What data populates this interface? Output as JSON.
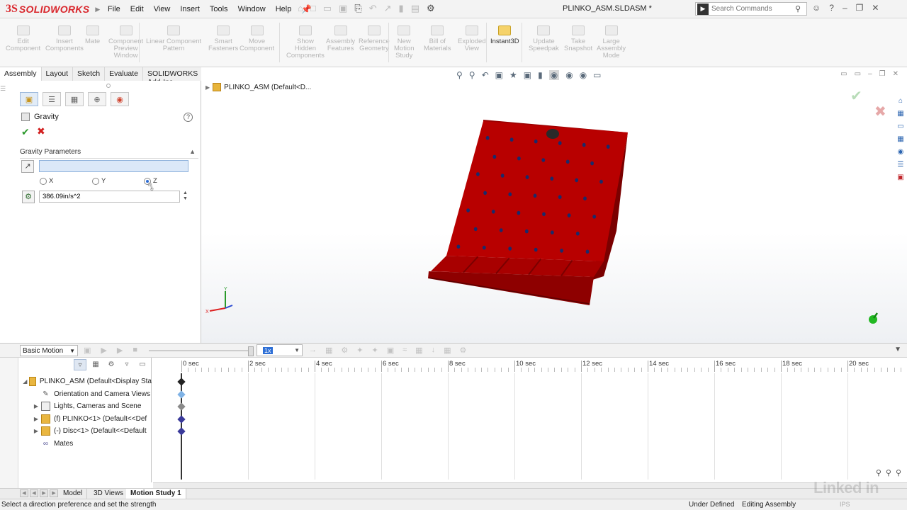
{
  "app": {
    "logo_mark": "3S",
    "logo_text": "SOLIDWORKS",
    "document_title": "PLINKO_ASM.SLDASM *"
  },
  "menu": [
    "File",
    "Edit",
    "View",
    "Insert",
    "Tools",
    "Window",
    "Help"
  ],
  "search": {
    "placeholder": "Search Commands"
  },
  "ribbon": [
    {
      "label": "Edit\nComponent",
      "enabled": false
    },
    {
      "label": "Insert\nComponents",
      "enabled": false
    },
    {
      "label": "Mate",
      "enabled": false
    },
    {
      "label": "Component\nPreview\nWindow",
      "enabled": false
    },
    {
      "label": "Linear Component\nPattern",
      "enabled": false
    },
    {
      "label": "Smart\nFasteners",
      "enabled": false
    },
    {
      "label": "Move\nComponent",
      "enabled": false
    },
    {
      "label": "Show\nHidden\nComponents",
      "enabled": false
    },
    {
      "label": "Assembly\nFeatures",
      "enabled": false
    },
    {
      "label": "Reference\nGeometry",
      "enabled": false
    },
    {
      "label": "New\nMotion\nStudy",
      "enabled": false
    },
    {
      "label": "Bill of\nMaterials",
      "enabled": false
    },
    {
      "label": "Exploded\nView",
      "enabled": false
    },
    {
      "label": "Instant3D",
      "enabled": true
    },
    {
      "label": "Update\nSpeedpak",
      "enabled": false
    },
    {
      "label": "Take\nSnapshot",
      "enabled": false
    },
    {
      "label": "Large\nAssembly\nMode",
      "enabled": false
    }
  ],
  "tabs": [
    "Assembly",
    "Layout",
    "Sketch",
    "Evaluate",
    "SOLIDWORKS Add-Ins"
  ],
  "property_manager": {
    "title": "Gravity",
    "group_title": "Gravity Parameters",
    "direction_value": "",
    "radio_x": "X",
    "radio_y": "Y",
    "radio_z": "Z",
    "selected_axis": "Z",
    "strength_value": "386.09in/s^2"
  },
  "graphics": {
    "tree_flyout_label": "PLINKO_ASM  (Default<D..."
  },
  "model_colors": {
    "board": "#b80000",
    "board_dark": "#7a0000",
    "pegs": "#1a2a6a"
  },
  "motion_manager": {
    "study_type": "Basic Motion",
    "playback_speed": "1x",
    "timeline_labels": [
      "0 sec",
      "2 sec",
      "4 sec",
      "6 sec",
      "8 sec",
      "10 sec",
      "12 sec",
      "14 sec",
      "16 sec",
      "18 sec",
      "20 sec"
    ],
    "tree": [
      {
        "label": "PLINKO_ASM  (Default<Display Sta",
        "icon": "assembly",
        "expandable": true,
        "expanded": true,
        "indent": 0
      },
      {
        "label": "Orientation and Camera Views",
        "icon": "camera",
        "expandable": false,
        "indent": 1
      },
      {
        "label": "Lights, Cameras and Scene",
        "icon": "lights",
        "expandable": true,
        "indent": 1
      },
      {
        "label": "(f) PLINKO<1> (Default<<Def",
        "icon": "part",
        "expandable": true,
        "indent": 1
      },
      {
        "label": "(-) Disc<1> (Default<<Default",
        "icon": "part",
        "expandable": true,
        "indent": 1
      },
      {
        "label": "Mates",
        "icon": "mates",
        "expandable": false,
        "indent": 1
      }
    ],
    "keys": [
      {
        "row": 0,
        "color": "#222222"
      },
      {
        "row": 1,
        "color": "#7fb2e5"
      },
      {
        "row": 2,
        "color": "#8a8a8a"
      },
      {
        "row": 3,
        "color": "#3a3a9a"
      },
      {
        "row": 4,
        "color": "#3a3a9a"
      }
    ]
  },
  "bottom_tabs": [
    "Model",
    "3D Views",
    "Motion Study 1"
  ],
  "active_bottom_tab": "Motion Study 1",
  "status": {
    "message": "Select a direction preference and set the strength",
    "definition": "Under Defined",
    "mode": "Editing Assembly",
    "units": "IPS"
  },
  "watermark": "Linked in"
}
